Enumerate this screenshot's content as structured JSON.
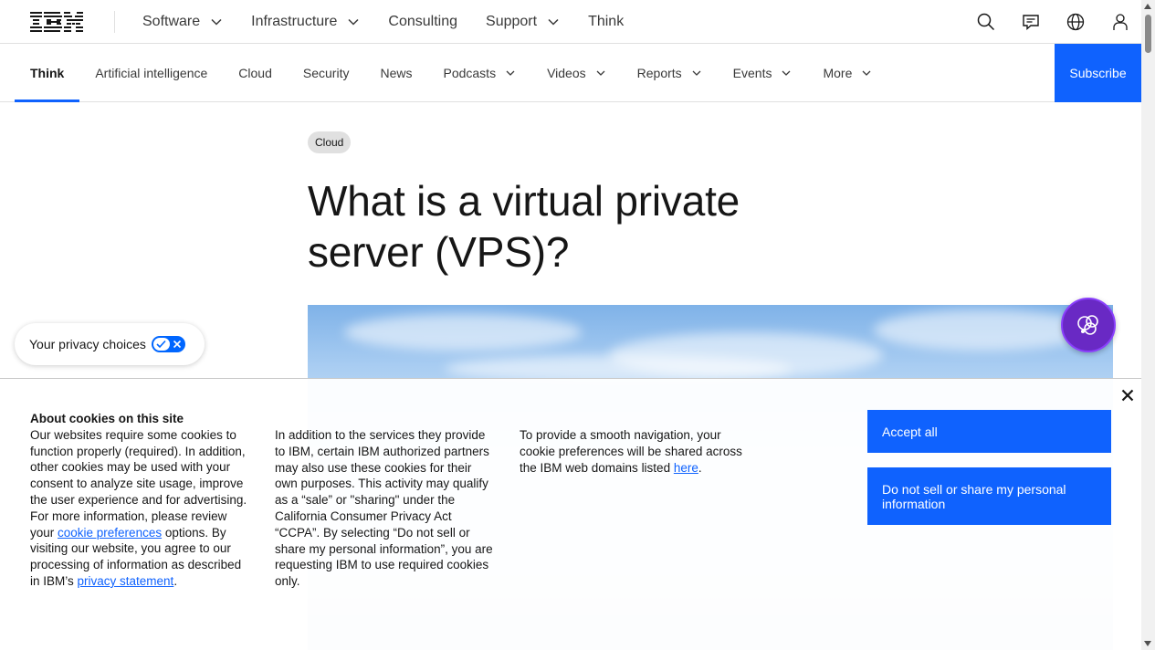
{
  "masthead": {
    "logo_text": "IBM",
    "nav": [
      {
        "label": "Software",
        "dropdown": true
      },
      {
        "label": "Infrastructure",
        "dropdown": true
      },
      {
        "label": "Consulting",
        "dropdown": false
      },
      {
        "label": "Support",
        "dropdown": true
      },
      {
        "label": "Think",
        "dropdown": false
      }
    ],
    "icons": [
      "search-icon",
      "chat-icon",
      "globe-icon",
      "user-icon"
    ]
  },
  "subnav": {
    "items": [
      {
        "label": "Think",
        "active": true
      },
      {
        "label": "Artificial intelligence"
      },
      {
        "label": "Cloud"
      },
      {
        "label": "Security"
      },
      {
        "label": "News"
      },
      {
        "label": "Podcasts",
        "dropdown": true
      },
      {
        "label": "Videos",
        "dropdown": true
      },
      {
        "label": "Reports",
        "dropdown": true
      },
      {
        "label": "Events",
        "dropdown": true
      },
      {
        "label": "More",
        "dropdown": true
      }
    ],
    "subscribe_label": "Subscribe"
  },
  "article": {
    "tag": "Cloud",
    "title_line1": "What is a virtual private",
    "title_line2": "server (VPS)?"
  },
  "privacy": {
    "label": "Your privacy choices"
  },
  "cookie_banner": {
    "heading": "About cookies on this site",
    "col1_text_a": "Our websites require some cookies to function properly (required). In addition, other cookies may be used with your consent to analyze site usage, improve the user experience and for advertising. For more information, please review your ",
    "col1_link_a": "cookie preferences",
    "col1_text_b": " options. By visiting our website, you agree to our processing of information as described in IBM’s ",
    "col1_link_b": "privacy statement",
    "col1_text_c": ".",
    "col2_text": "In addition to the services they provide to IBM, certain IBM authorized partners may also use these cookies for their own purposes. This activity may qualify as a “sale” or \"sharing\" under the California Consumer Privacy Act “CCPA”. By selecting “Do not sell or share my personal information”, you are requesting IBM to use required cookies only.",
    "col3_text_a": "To provide a smooth navigation, your cookie preferences will be shared across the IBM web domains listed ",
    "col3_link": "here",
    "col3_text_b": ".",
    "accept_label": "Accept all",
    "do_not_sell_label": "Do not sell or share my personal information"
  },
  "colors": {
    "accent": "#0f62fe",
    "chat_bg": "#6929c4",
    "text": "#161616"
  }
}
